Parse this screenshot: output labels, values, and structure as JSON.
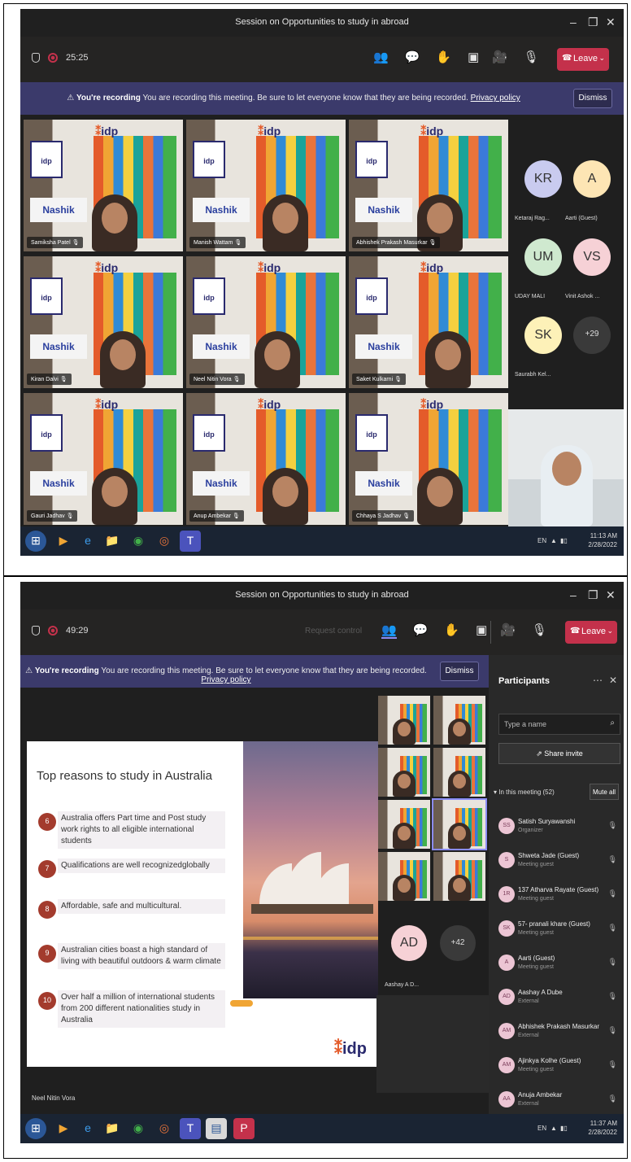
{
  "shot1": {
    "title": "Session on Opportunities to study in abroad",
    "timer": "25:25",
    "leave_label": "Leave",
    "banner": {
      "bold": "You're recording",
      "text": "You are recording this meeting. Be sure to let everyone know that they are being recorded.",
      "link": "Privacy policy",
      "dismiss": "Dismiss"
    },
    "tiles": [
      {
        "name": "Samiksha Patel",
        "city": "Nashik"
      },
      {
        "name": "Manish Wattam",
        "city": "Nashik"
      },
      {
        "name": "Abhishek Prakash Masurkar",
        "city": "Nashik"
      },
      {
        "name": "Kiran Dalvi",
        "city": "Nashik"
      },
      {
        "name": "Neel Nitin Vora",
        "city": "Nashik"
      },
      {
        "name": "Saket Kulkarni",
        "city": "Nashik"
      },
      {
        "name": "Gauri Jadhav",
        "city": "Nashik"
      },
      {
        "name": "Anup Ambekar",
        "city": "Nashik"
      },
      {
        "name": "Chhaya S Jadhav",
        "city": "Nashik"
      }
    ],
    "avatars": [
      {
        "initials": "KR",
        "name": "Ketaraj Rag...",
        "color": "#c9cbef"
      },
      {
        "initials": "A",
        "name": "Aarti (Guest)",
        "color": "#fde5b4"
      },
      {
        "initials": "UM",
        "name": "UDAY MALI",
        "color": "#cfe9cf"
      },
      {
        "initials": "VS",
        "name": "Vinit Ashok ...",
        "color": "#f6d1d6"
      },
      {
        "initials": "SK",
        "name": "Saurabh Kel...",
        "color": "#fdf1b8"
      },
      {
        "initials": "+29",
        "name": "",
        "color": "#3a3a3a"
      }
    ],
    "tray_time": "11:13 AM",
    "tray_date": "2/28/2022",
    "tray_lang": "EN"
  },
  "shot2": {
    "title": "Session on Opportunities to study in abroad",
    "timer": "49:29",
    "request_control": "Request control",
    "leave_label": "Leave",
    "banner": {
      "bold": "You're recording",
      "text": "You are recording this meeting. Be sure to let everyone know that they are being recorded.",
      "link": "Privacy policy",
      "dismiss": "Dismiss"
    },
    "slide": {
      "title": "Top reasons to study in Australia",
      "items": [
        {
          "num": "6",
          "text": "Australia offers Part time and Post study work rights to all eligible international students"
        },
        {
          "num": "7",
          "text": "Qualifications are well recognizedglobally"
        },
        {
          "num": "8",
          "text": "Affordable, safe and multicultural."
        },
        {
          "num": "9",
          "text": "Australian cities boast a high standard of living with beautiful outdoors & warm climate"
        },
        {
          "num": "10",
          "text": "Over half a million of international students from 200 different nationalities study in Australia"
        }
      ],
      "logo": "idp"
    },
    "presenter_name": "Neel Nitin Vora",
    "avatars": [
      {
        "initials": "AD",
        "name": "Aashay A D...",
        "color": "#f6d1d6"
      },
      {
        "initials": "+42",
        "name": "",
        "color": "#3a3a3a"
      },
      {
        "initials": "SS",
        "name": "",
        "color": "#f6d1d6"
      }
    ],
    "panel": {
      "title": "Participants",
      "search_placeholder": "Type a name",
      "share_invite": "Share invite",
      "in_meeting": "In this meeting (52)",
      "mute_all": "Mute all",
      "participants": [
        {
          "initials": "SS",
          "name": "Satish Suryawanshi",
          "role": "Organizer"
        },
        {
          "initials": "S",
          "name": "Shweta Jade (Guest)",
          "role": "Meeting guest"
        },
        {
          "initials": "1R",
          "name": "137 Atharva Rayate (Guest)",
          "role": "Meeting guest"
        },
        {
          "initials": "SK",
          "name": "57- pranali khare (Guest)",
          "role": "Meeting guest"
        },
        {
          "initials": "A",
          "name": "Aarti (Guest)",
          "role": "Meeting guest"
        },
        {
          "initials": "AD",
          "name": "Aashay A Dube",
          "role": "External"
        },
        {
          "initials": "AM",
          "name": "Abhishek Prakash Masurkar",
          "role": "External"
        },
        {
          "initials": "AM",
          "name": "Ajinkya Kolhe (Guest)",
          "role": "Meeting guest"
        },
        {
          "initials": "AA",
          "name": "Anuja Ambekar",
          "role": "External"
        }
      ]
    },
    "tray_time": "11:37 AM",
    "tray_date": "2/28/2022",
    "tray_lang": "EN"
  }
}
